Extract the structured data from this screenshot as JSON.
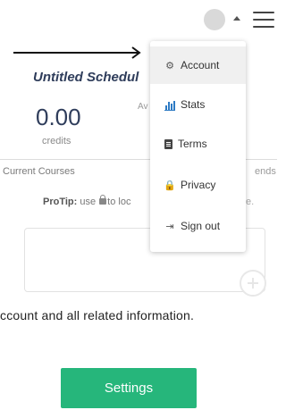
{
  "dropdown": {
    "items": [
      {
        "label": "Account",
        "icon": "gear-icon"
      },
      {
        "label": "Stats",
        "icon": "bar-chart-icon"
      },
      {
        "label": "Terms",
        "icon": "document-icon"
      },
      {
        "label": "Privacy",
        "icon": "lock-icon"
      },
      {
        "label": "Sign out",
        "icon": "sign-out-icon"
      }
    ]
  },
  "schedule": {
    "title": "Untitled Schedul",
    "credits": "0.00",
    "credits_label": "credits",
    "avail_label": "Av",
    "tab_courses": "Current Courses",
    "tab_ends": "ends",
    "protip_label": "ProTip:",
    "protip_text_a": "use",
    "protip_text_b": "to loc",
    "protip_end": "e."
  },
  "info_text": "ccount and all related information.",
  "settings_button": "Settings",
  "colors": {
    "accent": "#26b67b",
    "title": "#2f3d5b"
  }
}
